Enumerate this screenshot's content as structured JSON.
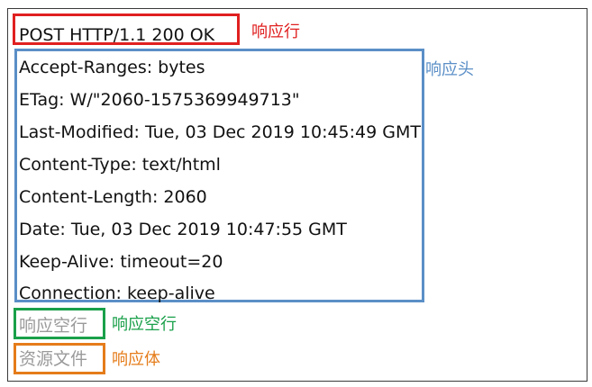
{
  "response": {
    "status_line": "POST HTTP/1.1 200 OK",
    "headers": [
      "Accept-Ranges: bytes",
      "ETag: W/\"2060-1575369949713\"",
      "Last-Modified: Tue, 03 Dec 2019 10:45:49 GMT",
      "Content-Type: text/html",
      "Content-Length: 2060",
      "Date: Tue, 03 Dec 2019 10:47:55 GMT",
      "Keep-Alive: timeout=20",
      "Connection: keep-alive"
    ],
    "blank_line_text": "响应空行",
    "body_text": "资源文件"
  },
  "labels": {
    "status_line": "响应行",
    "headers": "响应头",
    "blank_line": "响应空行",
    "body": "响应体"
  },
  "colors": {
    "status_line": "#e02020",
    "headers": "#5b8fc7",
    "blank_line": "#1aa04a",
    "body": "#e57c1a",
    "placeholder_text": "#9a9a9a"
  }
}
